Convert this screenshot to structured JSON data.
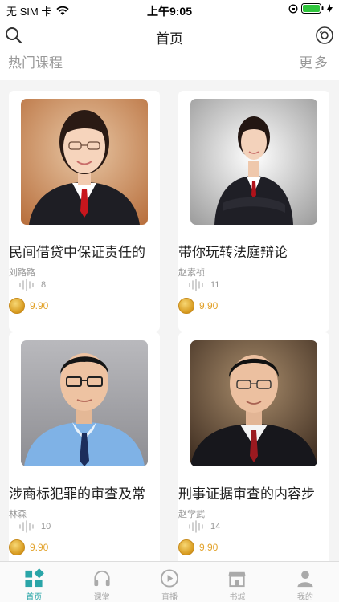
{
  "status": {
    "carrier": "无 SIM 卡",
    "time": "上午9:05"
  },
  "nav": {
    "title": "首页"
  },
  "section": {
    "title": "热门课程",
    "more": "更多"
  },
  "courses": [
    {
      "title": "民间借贷中保证责任的",
      "teacher": "刘路路",
      "plays": "8",
      "price": "9.90"
    },
    {
      "title": "带你玩转法庭辩论",
      "teacher": "赵素祯",
      "plays": "11",
      "price": "9.90"
    },
    {
      "title": "涉商标犯罪的审查及常",
      "teacher": "林森",
      "plays": "10",
      "price": "9.90"
    },
    {
      "title": "刑事证据审查的内容步",
      "teacher": "赵学武",
      "plays": "14",
      "price": "9.90"
    }
  ],
  "tabs": [
    {
      "label": "首页",
      "icon": "home-grid-icon"
    },
    {
      "label": "课堂",
      "icon": "headphones-icon"
    },
    {
      "label": "直播",
      "icon": "play-circle-icon"
    },
    {
      "label": "书城",
      "icon": "store-icon"
    },
    {
      "label": "我的",
      "icon": "person-icon"
    }
  ],
  "colors": {
    "accent": "#2aa5a8",
    "price": "#e2a22a"
  }
}
